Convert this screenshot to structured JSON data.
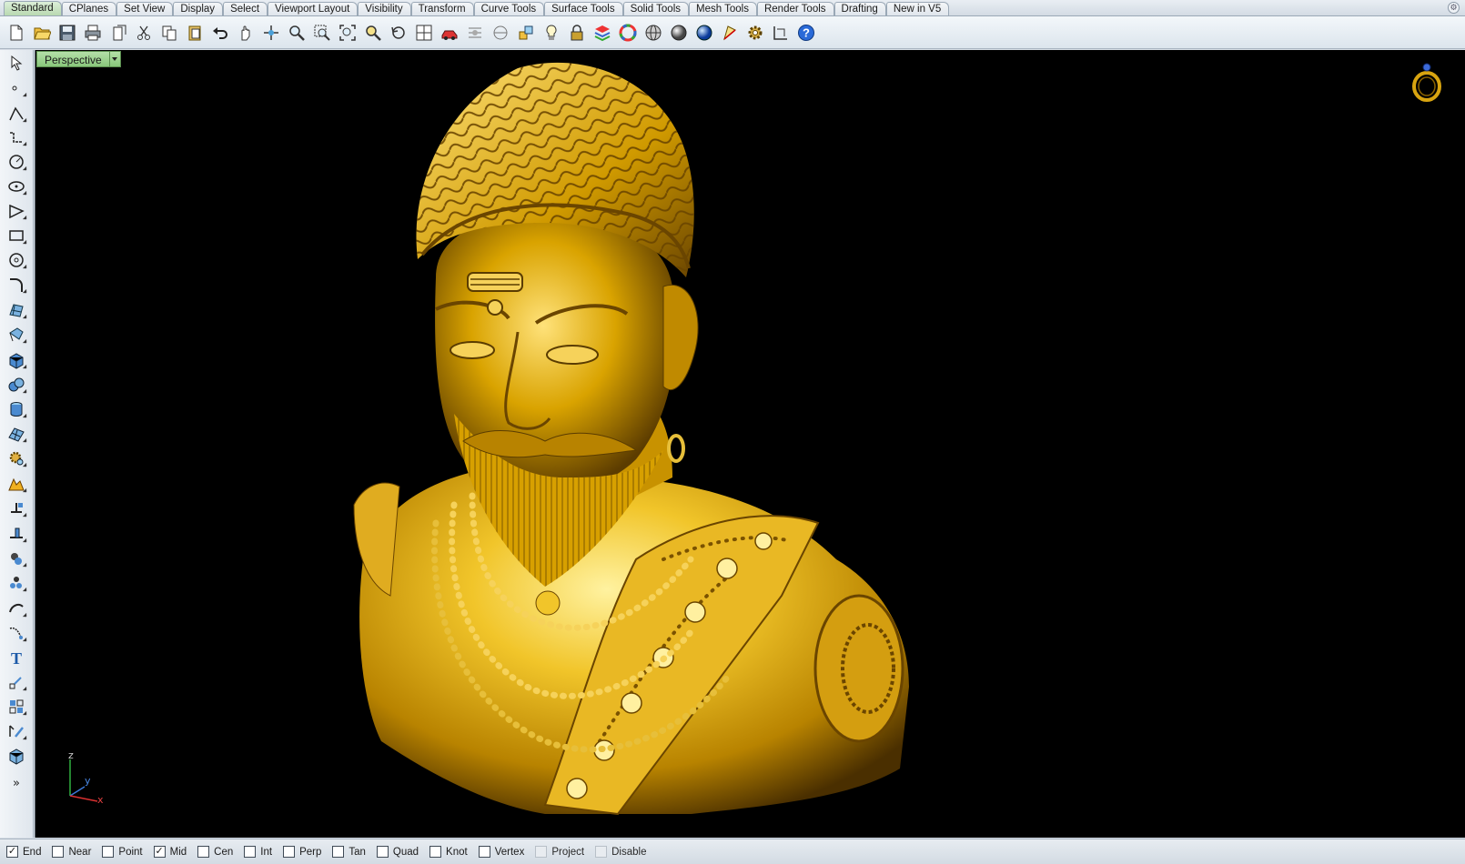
{
  "tabs": [
    {
      "label": "Standard",
      "active": true
    },
    {
      "label": "CPlanes"
    },
    {
      "label": "Set View"
    },
    {
      "label": "Display"
    },
    {
      "label": "Select"
    },
    {
      "label": "Viewport Layout"
    },
    {
      "label": "Visibility"
    },
    {
      "label": "Transform"
    },
    {
      "label": "Curve Tools"
    },
    {
      "label": "Surface Tools"
    },
    {
      "label": "Solid Tools"
    },
    {
      "label": "Mesh Tools"
    },
    {
      "label": "Render Tools"
    },
    {
      "label": "Drafting"
    },
    {
      "label": "New in V5"
    }
  ],
  "toolbar_icons": [
    "new-file-icon",
    "open-folder-icon",
    "save-icon",
    "print-icon",
    "import-icon",
    "cut-icon",
    "copy-icon",
    "paste-icon",
    "undo-icon",
    "pan-hand-icon",
    "rotate-view-icon",
    "zoom-icon",
    "zoom-window-icon",
    "zoom-extents-icon",
    "zoom-selected-icon",
    "undo-view-icon",
    "four-viewports-icon",
    "car-options-icon",
    "grid-toggle-icon",
    "cplane-icon",
    "snap-point-icon",
    "light-bulb-icon",
    "lock-icon",
    "layer-icon",
    "color-wheel-icon",
    "wireframe-sphere-icon",
    "shaded-sphere-icon",
    "rendered-sphere-icon",
    "render-icon",
    "gear-options-icon",
    "dimension-icon",
    "help-icon"
  ],
  "left_icons": [
    "select-arrow-icon",
    "point-icon",
    "polyline-icon",
    "curve-icon",
    "circle-icon",
    "ellipse-icon",
    "polygon-icon",
    "rectangle-icon",
    "arc-icon",
    "fillet-curve-icon",
    "surface-icon",
    "surface-from-curves-icon",
    "box-solid-icon",
    "sphere-solid-icon",
    "cylinder-solid-icon",
    "mesh-icon",
    "transform-gear-icon",
    "boolean-icon",
    "split-icon",
    "trim-icon",
    "join-icon",
    "explode-icon",
    "curve-from-object-icon",
    "project-curve-icon",
    "text-icon",
    "dimension-icon",
    "array-icon",
    "group-icon",
    "block-icon",
    "expand-icon"
  ],
  "viewport": {
    "title": "Perspective",
    "axis_labels": {
      "x": "x",
      "y": "y",
      "z": "z"
    }
  },
  "osnaps": [
    {
      "label": "End",
      "checked": true
    },
    {
      "label": "Near",
      "checked": false
    },
    {
      "label": "Point",
      "checked": false
    },
    {
      "label": "Mid",
      "checked": true
    },
    {
      "label": "Cen",
      "checked": false
    },
    {
      "label": "Int",
      "checked": false
    },
    {
      "label": "Perp",
      "checked": false
    },
    {
      "label": "Tan",
      "checked": false
    },
    {
      "label": "Quad",
      "checked": false
    },
    {
      "label": "Knot",
      "checked": false
    },
    {
      "label": "Vertex",
      "checked": false
    },
    {
      "label": "Project",
      "checked": false,
      "disabled": true
    },
    {
      "label": "Disable",
      "checked": false,
      "disabled": true
    }
  ],
  "colors": {
    "gold_light": "#ffe680",
    "gold_mid": "#e0a800",
    "gold_dark": "#5c3c00",
    "active_tab": "#b9d9b1",
    "viewport_bg": "#000000"
  }
}
